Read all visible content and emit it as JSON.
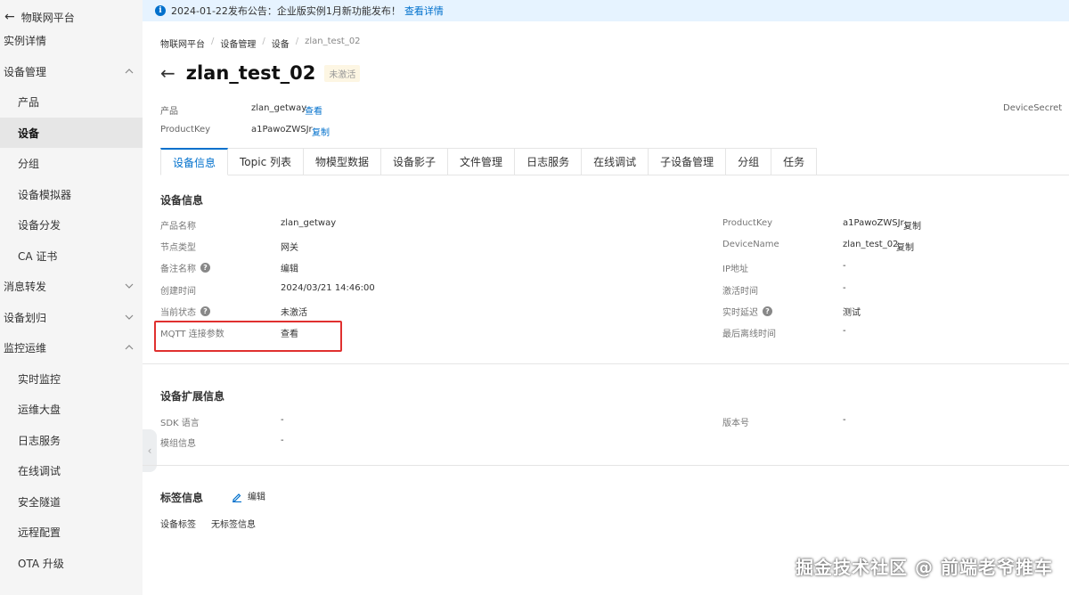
{
  "sidebar": {
    "platform_title": "物联网平台",
    "items": [
      {
        "label": "实例详情",
        "level": 1
      },
      {
        "label": "设备管理",
        "level": 1,
        "chevron": "up"
      },
      {
        "label": "产品",
        "level": 2
      },
      {
        "label": "设备",
        "level": 2,
        "active": true
      },
      {
        "label": "分组",
        "level": 2
      },
      {
        "label": "设备模拟器",
        "level": 2
      },
      {
        "label": "设备分发",
        "level": 2
      },
      {
        "label": "CA 证书",
        "level": 2
      },
      {
        "label": "消息转发",
        "level": 1,
        "chevron": "down"
      },
      {
        "label": "设备划归",
        "level": 1,
        "chevron": "down"
      },
      {
        "label": "监控运维",
        "level": 1,
        "chevron": "up"
      },
      {
        "label": "实时监控",
        "level": 2
      },
      {
        "label": "运维大盘",
        "level": 2
      },
      {
        "label": "日志服务",
        "level": 2
      },
      {
        "label": "在线调试",
        "level": 2
      },
      {
        "label": "安全隧道",
        "level": 2
      },
      {
        "label": "远程配置",
        "level": 2
      },
      {
        "label": "OTA 升级",
        "level": 2
      }
    ]
  },
  "notice": {
    "text": "2024-01-22发布公告：企业版实例1月新功能发布！",
    "link": "查看详情",
    "icon": "info-icon"
  },
  "breadcrumb": [
    "物联网平台",
    "设备管理",
    "设备",
    "zlan_test_02"
  ],
  "device": {
    "name": "zlan_test_02",
    "status_badge": "未激活",
    "product_label": "产品",
    "product_value": "zlan_getway",
    "product_link": "查看",
    "productkey_label": "ProductKey",
    "productkey_value": "a1PawoZWSJr",
    "productkey_copy": "复制",
    "devicesecret_label": "DeviceSecret"
  },
  "tabs": [
    {
      "label": "设备信息",
      "active": true
    },
    {
      "label": "Topic 列表"
    },
    {
      "label": "物模型数据"
    },
    {
      "label": "设备影子"
    },
    {
      "label": "文件管理"
    },
    {
      "label": "日志服务"
    },
    {
      "label": "在线调试"
    },
    {
      "label": "子设备管理"
    },
    {
      "label": "分组"
    },
    {
      "label": "任务"
    }
  ],
  "device_info": {
    "title": "设备信息",
    "left": [
      {
        "label": "产品名称",
        "value": "zlan_getway"
      },
      {
        "label": "节点类型",
        "value": "网关"
      },
      {
        "label": "备注名称",
        "value": "编辑",
        "help": true,
        "link": true
      },
      {
        "label": "创建时间",
        "value": "2024/03/21 14:46:00"
      },
      {
        "label": "当前状态",
        "value": "未激活",
        "help": true
      },
      {
        "label": "MQTT 连接参数",
        "value": "查看",
        "link": true
      }
    ],
    "right": [
      {
        "label": "ProductKey",
        "value": "a1PawoZWSJr",
        "copy": "复制"
      },
      {
        "label": "DeviceName",
        "value": "zlan_test_02",
        "copy": "复制"
      },
      {
        "label": "IP地址",
        "value": "-"
      },
      {
        "label": "激活时间",
        "value": "-"
      },
      {
        "label": "实时延迟",
        "value": "测试",
        "help": true,
        "link": true
      },
      {
        "label": "最后离线时间",
        "value": "-"
      }
    ]
  },
  "ext_info": {
    "title": "设备扩展信息",
    "sdk_label": "SDK 语言",
    "sdk_value": "-",
    "module_label": "模组信息",
    "module_value": "-",
    "version_label": "版本号",
    "version_value": "-"
  },
  "tag_info": {
    "title": "标签信息",
    "edit": "编辑",
    "tag_label": "设备标签",
    "tag_value": "无标签信息"
  },
  "watermark": "掘金技术社区 @ 前端老爷推车",
  "colors": {
    "accent": "#0070cc",
    "highlight": "#e0302f",
    "notice_bg": "#e6f3ff"
  }
}
